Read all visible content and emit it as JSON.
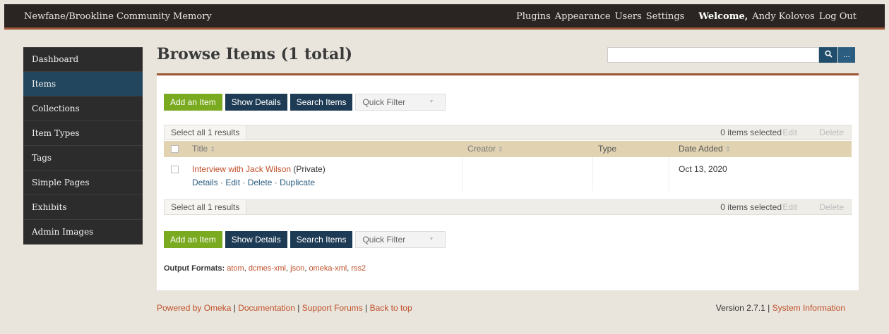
{
  "topbar": {
    "site_title": "Newfane/Brookline Community Memory",
    "nav": [
      "Plugins",
      "Appearance",
      "Users",
      "Settings"
    ],
    "welcome_label": "Welcome,",
    "user_name": "Andy Kolovos",
    "logout": "Log Out"
  },
  "sidebar": {
    "items": [
      {
        "label": "Dashboard",
        "active": false
      },
      {
        "label": "Items",
        "active": true
      },
      {
        "label": "Collections",
        "active": false
      },
      {
        "label": "Item Types",
        "active": false
      },
      {
        "label": "Tags",
        "active": false
      },
      {
        "label": "Simple Pages",
        "active": false
      },
      {
        "label": "Exhibits",
        "active": false
      },
      {
        "label": "Admin Images",
        "active": false
      }
    ]
  },
  "page": {
    "title": "Browse Items (1 total)"
  },
  "search": {
    "placeholder": "",
    "search_icon": "search-icon",
    "more_label": "..."
  },
  "toolbar": {
    "add_item": "Add an Item",
    "show_details": "Show Details",
    "search_items": "Search Items",
    "quick_filter": "Quick Filter"
  },
  "results_bar": {
    "select_all": "Select all 1 results",
    "selected_count": "0 items selected",
    "edit": "Edit",
    "delete": "Delete"
  },
  "table": {
    "columns": [
      "Title",
      "Creator",
      "Type",
      "Date Added"
    ],
    "rows": [
      {
        "title": "Interview with Jack Wilson",
        "visibility": "(Private)",
        "actions": [
          "Details",
          "Edit",
          "Delete",
          "Duplicate"
        ],
        "creator": "",
        "type": "",
        "date_added": "Oct 13, 2020"
      }
    ]
  },
  "output_formats": {
    "label": "Output Formats:",
    "formats": [
      "atom",
      "dcmes-xml",
      "json",
      "omeka-xml",
      "rss2"
    ]
  },
  "footer": {
    "links": [
      "Powered by Omeka",
      "Documentation",
      "Support Forums",
      "Back to top"
    ],
    "version": "Version 2.7.1",
    "system_info": "System Information"
  },
  "colors": {
    "topbar": "#2a2522",
    "accent_rule": "#a05a3a",
    "sidebar": "#2c2c2c",
    "sidebar_active": "#21465e",
    "green_button": "#7aaa1f",
    "navy_button": "#1e3b55",
    "link": "#c0502a",
    "table_header": "#e1d3b2"
  }
}
